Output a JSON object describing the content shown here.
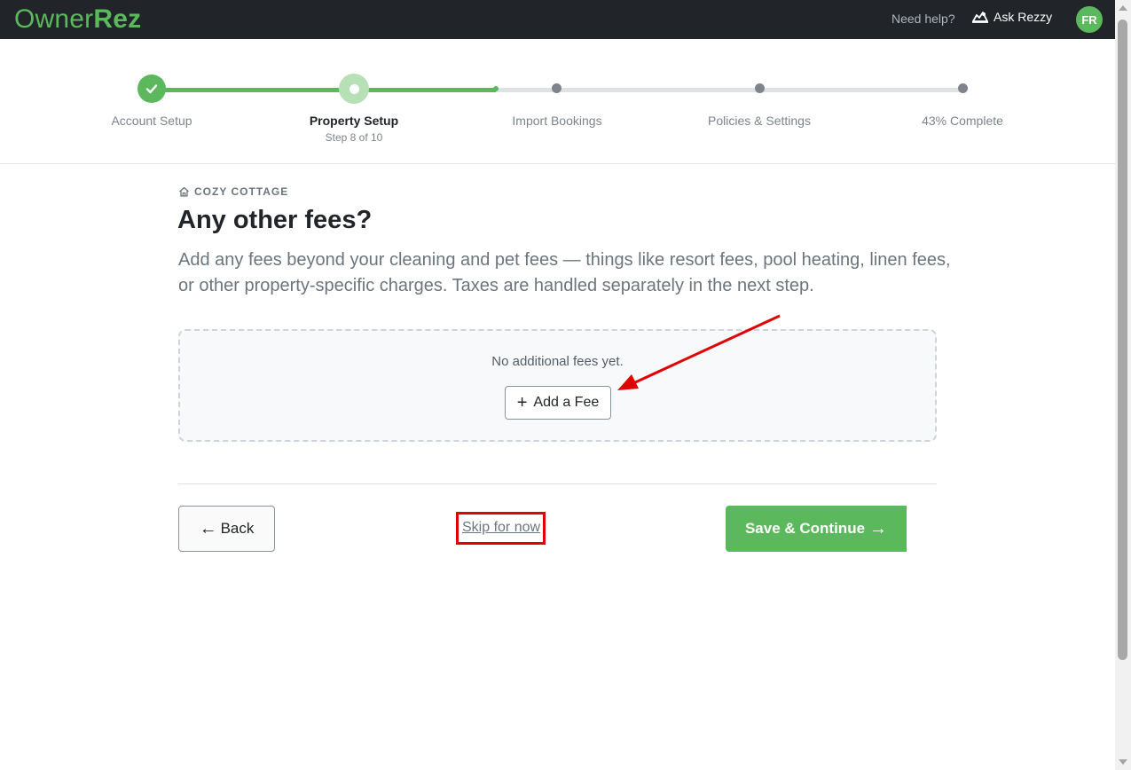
{
  "header": {
    "brand_part1": "Owner",
    "brand_part2": "Rez",
    "need_help": "Need help?",
    "ask_rezzy": "Ask Rezzy",
    "avatar_initials": "FR",
    "icons": [
      "rezzy-icon"
    ]
  },
  "stepper": {
    "steps": [
      {
        "label": "Account Setup",
        "state": "complete"
      },
      {
        "label": "Property Setup",
        "state": "current",
        "sub": "Step 8 of 10"
      },
      {
        "label": "Import Bookings",
        "state": "upcoming"
      },
      {
        "label": "Policies & Settings",
        "state": "upcoming"
      },
      {
        "label": "43% Complete",
        "state": "upcoming"
      }
    ],
    "progress_fraction": 0.43
  },
  "property": {
    "name": "COZY COTTAGE",
    "icon": "home-icon"
  },
  "main": {
    "title": "Any other fees?",
    "description": "Add any fees beyond your cleaning and pet fees — things like resort fees, pool heating, linen fees, or other property-specific charges. Taxes are handled separately in the next step.",
    "empty_state": "No additional fees yet.",
    "add_fee_label": "Add a Fee"
  },
  "footer": {
    "back_label": "Back",
    "skip_label": "Skip for now",
    "save_label": "Save & Continue"
  },
  "colors": {
    "brand_green": "#5cb85c",
    "topbar": "#212529",
    "annotation_red": "#e00000"
  }
}
